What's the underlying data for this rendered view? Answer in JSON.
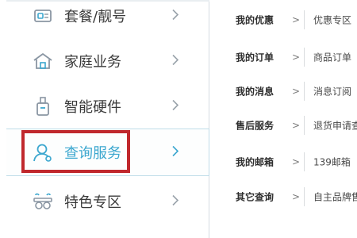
{
  "sidebar": {
    "items": [
      {
        "label": "套餐/靓号",
        "icon": "sim-card-icon"
      },
      {
        "label": "家庭业务",
        "icon": "home-icon"
      },
      {
        "label": "智能硬件",
        "icon": "device-icon"
      },
      {
        "label": "查询服务",
        "icon": "user-search-icon",
        "active": true
      },
      {
        "label": "特色专区",
        "icon": "glasses-icon"
      }
    ]
  },
  "submenu": {
    "rows": [
      {
        "key": "我的优惠",
        "arrow": ">",
        "value": "优惠专区"
      },
      {
        "key": "我的订单",
        "arrow": ">",
        "value": "商品订单"
      },
      {
        "key": "我的消息",
        "arrow": ">",
        "value": "消息订阅"
      },
      {
        "key": "售后服务",
        "arrow": ">",
        "value": "退货申请查询"
      },
      {
        "key": "我的邮箱",
        "arrow": ">",
        "value": "139邮箱"
      },
      {
        "key": "其它查询",
        "arrow": ">",
        "value": "自主品牌售后"
      }
    ]
  },
  "colors": {
    "accent": "#3ca7cf",
    "highlight_box": "#c0282d",
    "icon_gray": "#8a96a3"
  }
}
